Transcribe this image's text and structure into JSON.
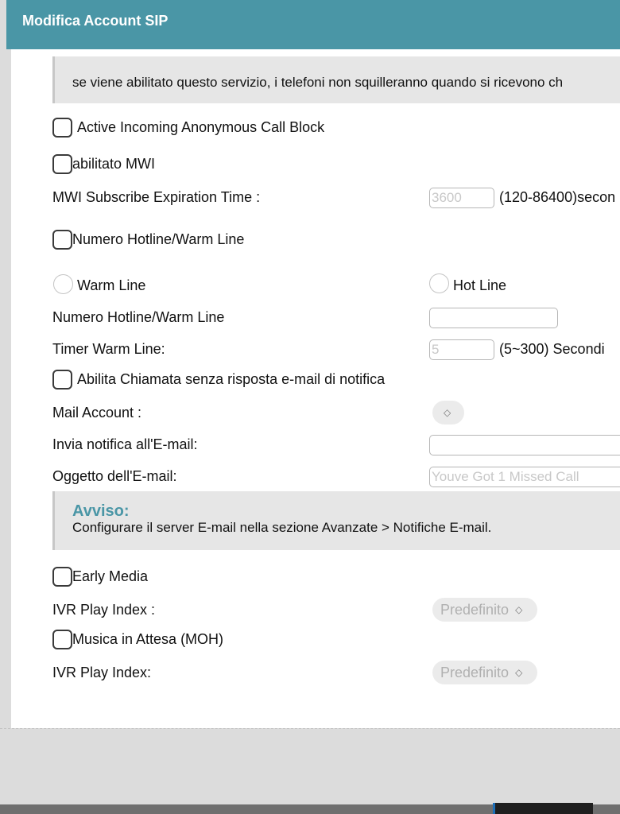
{
  "window": {
    "title": "Modifica Account SIP"
  },
  "info": {
    "text": "se viene abilitato questo servizio, i telefoni non squilleranno quando si ricevono ch"
  },
  "anonymous_block": {
    "label": "Active Incoming Anonymous Call Block",
    "checked": false
  },
  "mwi": {
    "label": "abilitato MWI",
    "checked": false
  },
  "mwi_expiration": {
    "label": "MWI Subscribe Expiration Time :",
    "value": "3600",
    "range": "(120-86400)secon"
  },
  "hotline": {
    "label": "Numero Hotline/Warm Line",
    "checked": false
  },
  "line_type": {
    "warm_label": "Warm Line",
    "hot_label": "Hot Line"
  },
  "hotline_number": {
    "label": "Numero Hotline/Warm Line",
    "value": ""
  },
  "warm_timer": {
    "label": "Timer Warm Line:",
    "value": "5",
    "range": "(5~300) Secondi"
  },
  "missed_call_email": {
    "label": "Abilita Chiamata senza risposta e-mail di notifica",
    "checked": false
  },
  "mail_account": {
    "label": "Mail Account :"
  },
  "notify_email": {
    "label": "Invia notifica all'E-mail:",
    "value": ""
  },
  "email_subject": {
    "label": "Oggetto dell'E-mail:",
    "value": "Youve Got 1 Missed Call"
  },
  "notice": {
    "title": "Avviso:",
    "text": "Configurare il server E-mail nella sezione Avanzate > Notifiche E-mail."
  },
  "early_media": {
    "label": "Early Media",
    "checked": false
  },
  "ivr_play_index_1": {
    "label": "IVR Play Index :",
    "value": "Predefinito"
  },
  "moh": {
    "label": "Musica in Attesa (MOH)",
    "checked": false
  },
  "ivr_play_index_2": {
    "label": "IVR Play Index:",
    "value": "Predefinito"
  },
  "colors": {
    "titlebar": "#4a96a6",
    "accent": "#4a96a6"
  }
}
